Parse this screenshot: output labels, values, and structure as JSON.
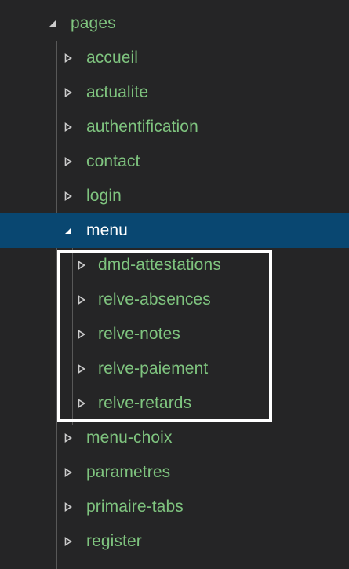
{
  "explorer": {
    "root": {
      "label": "pages",
      "expanded": true
    },
    "folders": [
      {
        "label": "accueil",
        "expanded": false
      },
      {
        "label": "actualite",
        "expanded": false
      },
      {
        "label": "authentification",
        "expanded": false
      },
      {
        "label": "contact",
        "expanded": false
      },
      {
        "label": "login",
        "expanded": false
      },
      {
        "label": "menu",
        "expanded": true,
        "selected": true,
        "children": [
          {
            "label": "dmd-attestations",
            "expanded": false
          },
          {
            "label": "relve-absences",
            "expanded": false
          },
          {
            "label": "relve-notes",
            "expanded": false
          },
          {
            "label": "relve-paiement",
            "expanded": false
          },
          {
            "label": "relve-retards",
            "expanded": false
          }
        ]
      },
      {
        "label": "menu-choix",
        "expanded": false
      },
      {
        "label": "parametres",
        "expanded": false
      },
      {
        "label": "primaire-tabs",
        "expanded": false
      },
      {
        "label": "register",
        "expanded": false
      }
    ]
  },
  "colors": {
    "background": "#252526",
    "folder_text": "#7fc47f",
    "selected_background": "#094771",
    "selected_text": "#ffffff",
    "highlight_border": "#ffffff"
  }
}
